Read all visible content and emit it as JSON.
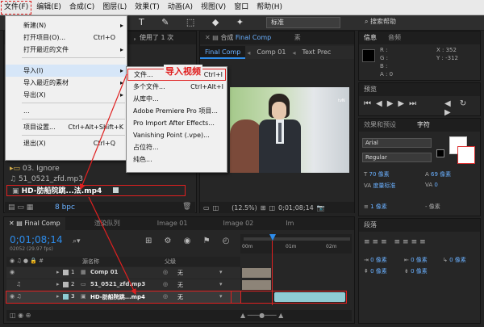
{
  "menubar": [
    "文件(F)",
    "编辑(E)",
    "合成(C)",
    "图层(L)",
    "效果(T)",
    "动画(A)",
    "视图(V)",
    "窗口",
    "帮助(H)"
  ],
  "toolbar": {
    "standard": "标准",
    "search": "搜索帮助"
  },
  "file_menu": {
    "items": [
      {
        "label": "新建(N)",
        "shortcut": "",
        "arrow": true
      },
      {
        "label": "打开项目(O)...",
        "shortcut": "Ctrl+O",
        "arrow": false
      },
      {
        "label": "打开最近的文件",
        "shortcut": "",
        "arrow": true
      },
      {
        "label": "导入(I)",
        "shortcut": "",
        "arrow": true
      },
      {
        "label": "导入最近的素材",
        "shortcut": "",
        "arrow": true
      },
      {
        "label": "导出(X)",
        "shortcut": "",
        "arrow": true
      },
      {
        "label": "...",
        "shortcut": "",
        "arrow": false
      },
      {
        "label": "项目设置...",
        "shortcut": "Ctrl+Alt+Shift+K",
        "arrow": false
      },
      {
        "label": "退出(X)",
        "shortcut": "Ctrl+Q",
        "arrow": false
      }
    ]
  },
  "import_menu": {
    "items": [
      {
        "label": "文件...",
        "shortcut": "Ctrl+I"
      },
      {
        "label": "多个文件...",
        "shortcut": "Ctrl+Alt+I"
      },
      {
        "label": "从库中...",
        "shortcut": ""
      },
      {
        "label": "Adobe Premiere Pro 项目...",
        "shortcut": ""
      },
      {
        "label": "Pro Import After Effects...",
        "shortcut": ""
      },
      {
        "label": "Vanishing Point (.vpe)...",
        "shortcut": ""
      },
      {
        "label": "占位符...",
        "shortcut": ""
      },
      {
        "label": "纯色...",
        "shortcut": ""
      }
    ],
    "annotation": "导入视频"
  },
  "project_partial": {
    "used": "，使用了 1 次"
  },
  "project_files": [
    {
      "name": "03. Ignore"
    },
    {
      "name": "51_0521_zfd.mp3"
    },
    {
      "name": "HD-肪船院跳...法.mp4"
    }
  ],
  "project_footer": {
    "bpc": "8 bpc"
  },
  "comp_panel": {
    "tab": "合成",
    "tab_name": "Final Comp",
    "subtabs": [
      "Final Comp",
      "Comp 01",
      "Text Prec"
    ],
    "zoom": "(12.5%)",
    "timecode": "0;01;08;14",
    "extra": "素"
  },
  "info_panel": {
    "tab1": "信息",
    "tab2": "音频",
    "r": "R :",
    "g": "G :",
    "b": "B :",
    "a": "A : 0",
    "x": "X : 352",
    "y": "Y : -312"
  },
  "preview_panel": {
    "title": "预览"
  },
  "effects_panel": {
    "tab1": "效果和预设",
    "tab2": "字符"
  },
  "character_panel": {
    "font": "Arial",
    "style": "Regular",
    "size": "70 像素",
    "leading": "69 像素",
    "kerning": "度量标准",
    "tracking": "0",
    "stroke_width": "1 像素",
    "stroke_label": "- 像素"
  },
  "paragraph_panel": {
    "title": "段落",
    "indent": [
      "0 像素",
      "0 像素",
      "0 像素",
      "0 像素",
      "0 像素"
    ]
  },
  "timeline": {
    "tabs": [
      "Final Comp",
      "渲染队列",
      "Image 01",
      "Image 02",
      "Im"
    ],
    "timecode": "0;01;08;14",
    "sub": "02052 (29.97 fps)",
    "col_name": "源名称",
    "col_parent": "父级",
    "ruler": [
      "00m",
      "01m",
      "02m"
    ],
    "layers": [
      {
        "num": "1",
        "name": "Comp 01",
        "parent": "无"
      },
      {
        "num": "2",
        "name": "51_0521_zfd.mp3",
        "parent": "无"
      },
      {
        "num": "3",
        "name": "HD-肪船院跳...mp4",
        "parent": "无"
      }
    ]
  },
  "colors": {
    "accent": "#2d8ceb",
    "highlight_red": "#e02020",
    "menu_bg": "#f0f0f0"
  }
}
